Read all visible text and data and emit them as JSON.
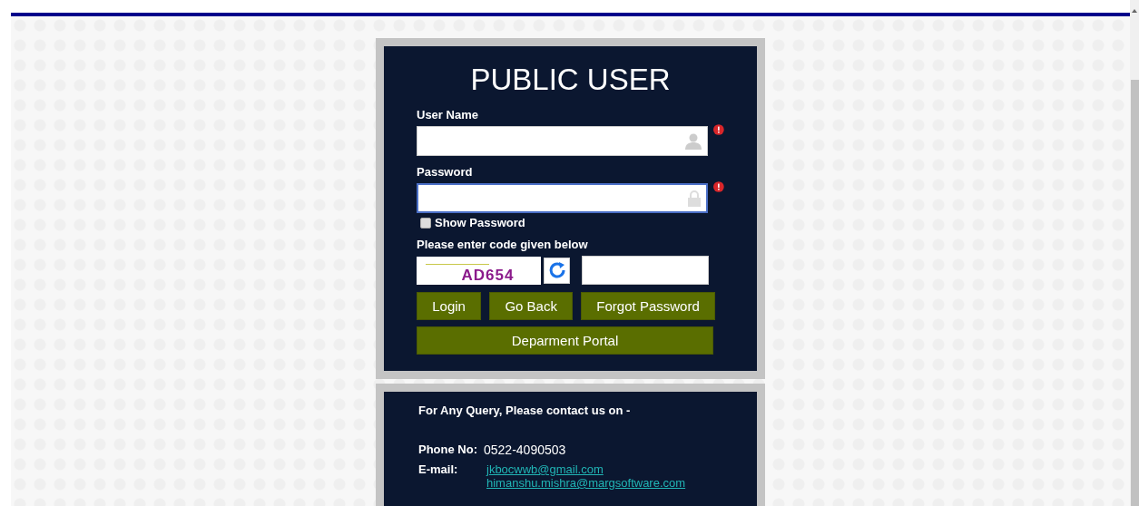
{
  "title": "PUBLIC USER",
  "fields": [
    {
      "label": "User Name",
      "kind": "user",
      "focused": false,
      "required": true
    },
    {
      "label": "Password",
      "kind": "lock",
      "focused": true,
      "required": true
    }
  ],
  "show_password": {
    "label": "Show Password",
    "checked": false
  },
  "captcha": {
    "label": "Please enter code given below",
    "code": "AD654"
  },
  "buttons": [
    "Login",
    "Go Back",
    "Forgot Password"
  ],
  "wide_button": "Deparment Portal",
  "contact": {
    "heading": "For Any Query, Please contact us on -",
    "phone_label": "Phone No:",
    "phone": "0522-4090503",
    "email_label": "E-mail:",
    "emails": [
      "jkbocwwb@gmail.com",
      "himanshu.mishra@margsoftware.com"
    ]
  }
}
